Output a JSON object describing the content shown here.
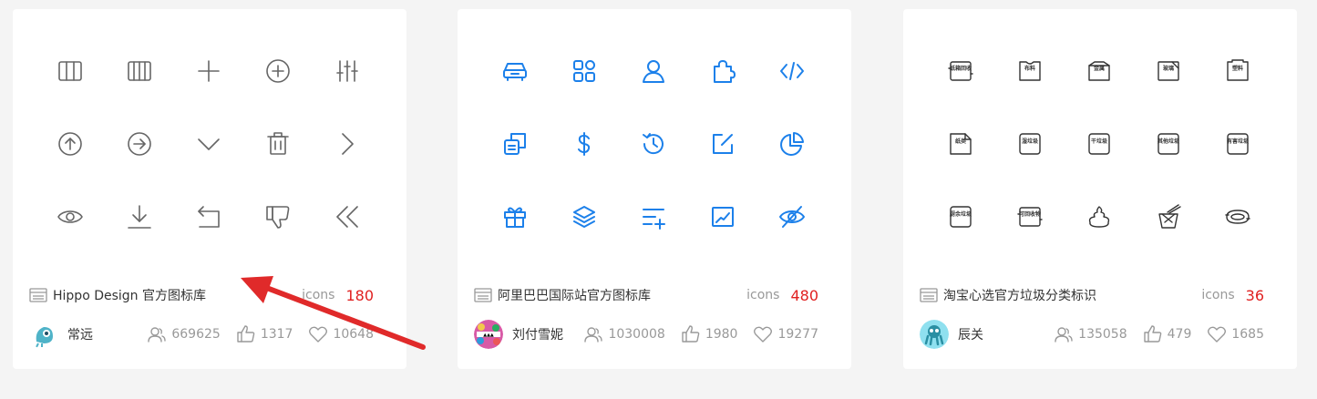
{
  "cards": [
    {
      "title": "Hippo Design 官方图标库",
      "icons_label": "icons",
      "icons_count": "180",
      "author": "常远",
      "contributors": "669625",
      "likes": "1317",
      "favorites": "10648",
      "icon_color": "#666666",
      "preview_icons": [
        "columns-3-icon",
        "columns-4-icon",
        "plus-icon",
        "plus-circle-icon",
        "sliders-icon",
        "arrow-up-circle-icon",
        "arrow-right-circle-icon",
        "chevron-down-icon",
        "trash-icon",
        "chevron-right-icon",
        "eye-icon",
        "download-icon",
        "return-icon",
        "thumbs-down-icon",
        "chevrons-left-icon"
      ]
    },
    {
      "title": "阿里巴巴国际站官方图标库",
      "icons_label": "icons",
      "icons_count": "480",
      "author": "刘付雪妮",
      "contributors": "1030008",
      "likes": "1980",
      "favorites": "19277",
      "icon_color": "#1c80ea",
      "preview_icons": [
        "car-icon",
        "grid-icon",
        "user-icon",
        "puzzle-icon",
        "code-icon",
        "copy-icon",
        "dollar-icon",
        "history-icon",
        "edit-icon",
        "pie-chart-icon",
        "gift-icon",
        "layers-icon",
        "list-add-icon",
        "trend-icon",
        "eye-off-icon"
      ]
    },
    {
      "title": "淘宝心选官方垃圾分类标识",
      "icons_label": "icons",
      "icons_count": "36",
      "author": "辰关",
      "contributors": "135058",
      "likes": "479",
      "favorites": "1685",
      "icon_color": "#333333",
      "tag_labels": [
        "纸箱回收",
        "布料",
        "金属",
        "玻璃",
        "塑料",
        "纸类",
        "湿垃圾",
        "干垃圾",
        "其他垃圾",
        "有害垃圾",
        "厨余垃圾",
        "可回收物"
      ],
      "preview_icons": [
        "recycle-box-icon",
        "fabric-icon",
        "metal-icon",
        "glass-icon",
        "plastic-icon",
        "paper-icon",
        "wet-waste-icon",
        "dry-waste-icon",
        "other-waste-icon",
        "hazardous-waste-icon",
        "kitchen-waste-icon",
        "recyclable-icon",
        "poop-icon",
        "takeout-box-icon",
        "snack-icon"
      ]
    }
  ]
}
